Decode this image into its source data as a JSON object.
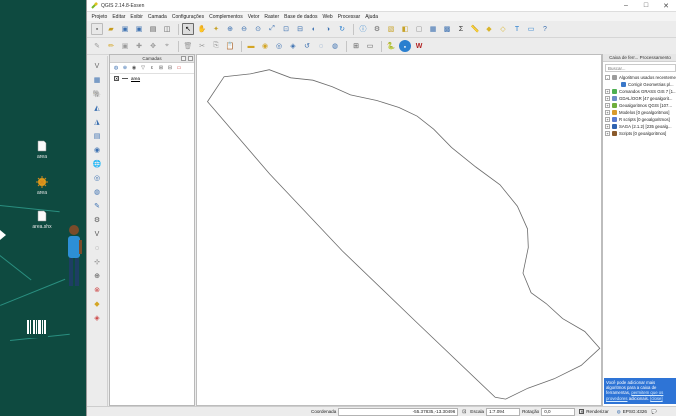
{
  "window": {
    "title": "QGIS 2.14.8-Essen"
  },
  "desktop": {
    "icons": [
      {
        "label": "area"
      },
      {
        "label": "area"
      },
      {
        "label": "area.shx"
      }
    ]
  },
  "menu": [
    "Projeto",
    "Editar",
    "Exibir",
    "Camada",
    "Configurações",
    "Complementos",
    "Vetor",
    "Raster",
    "Base de dados",
    "Web",
    "Processar",
    "Ajuda"
  ],
  "layers_panel": {
    "title": "Camadas",
    "items": [
      {
        "name": "area",
        "checked": true
      }
    ]
  },
  "processing_panel": {
    "title": "Caixa de ferr... Processamento",
    "search_placeholder": "Buscar...",
    "tree": [
      {
        "label": "Algoritmos usados recentemente",
        "expanded": true,
        "icon_color": "#9c9c9c"
      },
      {
        "label": "Corrigir Geometrias pl...",
        "child": true,
        "icon_color": "#3a78c9"
      },
      {
        "label": "Comandos GRASS GIS 7 [1...",
        "icon_color": "#4caf50"
      },
      {
        "label": "GDAL/OGR [47 geoalgorit...",
        "icon_color": "#6b8cc7"
      },
      {
        "label": "Geoalgoritmos QGIS [107...",
        "icon_color": "#6fae3c"
      },
      {
        "label": "Modelos [0 geoalgoritmos]",
        "icon_color": "#d99a2b"
      },
      {
        "label": "R scripts [0 geoalgoritmos]",
        "icon_color": "#5a7bd0"
      },
      {
        "label": "SAGA (2.1.2) [235 geoalg...",
        "icon_color": "#2e62b0"
      },
      {
        "label": "Scripts [0 geoalgoritmos]",
        "icon_color": "#8a5a2b"
      }
    ],
    "notice": {
      "text": "Você pode adicionar mais algoritmos para a caixa de ferramentas,",
      "link1": "permitem que os provedores",
      "middle": " adicionais.",
      "link2": "[close]"
    }
  },
  "status": {
    "coord_label": "Coordenada",
    "coord_value": "-55.37835,-13.30496",
    "scale_label": "Escala",
    "scale_value": "1:7.094",
    "rotation_label": "Rotação",
    "rotation_value": "0,0",
    "render_label": "Renderizar",
    "epsg": "EPSG:4326"
  },
  "map": {
    "polygon": [
      [
        0.026,
        0.133
      ],
      [
        0.067,
        0.062
      ],
      [
        0.132,
        0.054
      ],
      [
        0.179,
        0.042
      ],
      [
        0.232,
        0.065
      ],
      [
        0.287,
        0.072
      ],
      [
        0.335,
        0.091
      ],
      [
        0.38,
        0.114
      ],
      [
        0.445,
        0.13
      ],
      [
        0.5,
        0.15
      ],
      [
        0.545,
        0.175
      ],
      [
        0.586,
        0.212
      ],
      [
        0.63,
        0.264
      ],
      [
        0.69,
        0.32
      ],
      [
        0.75,
        0.371
      ],
      [
        0.793,
        0.432
      ],
      [
        0.818,
        0.497
      ],
      [
        0.82,
        0.55
      ],
      [
        0.807,
        0.623
      ],
      [
        0.827,
        0.679
      ],
      [
        0.864,
        0.71
      ],
      [
        0.905,
        0.753
      ],
      [
        0.96,
        0.79
      ],
      [
        0.997,
        0.838
      ],
      [
        0.951,
        0.887
      ],
      [
        0.884,
        0.925
      ],
      [
        0.819,
        0.952
      ],
      [
        0.764,
        0.983
      ],
      [
        0.738,
        0.978
      ],
      [
        0.54,
        0.76
      ],
      [
        0.36,
        0.56
      ],
      [
        0.18,
        0.34
      ],
      [
        0.026,
        0.133
      ]
    ],
    "stroke": "#6b6b6b"
  }
}
